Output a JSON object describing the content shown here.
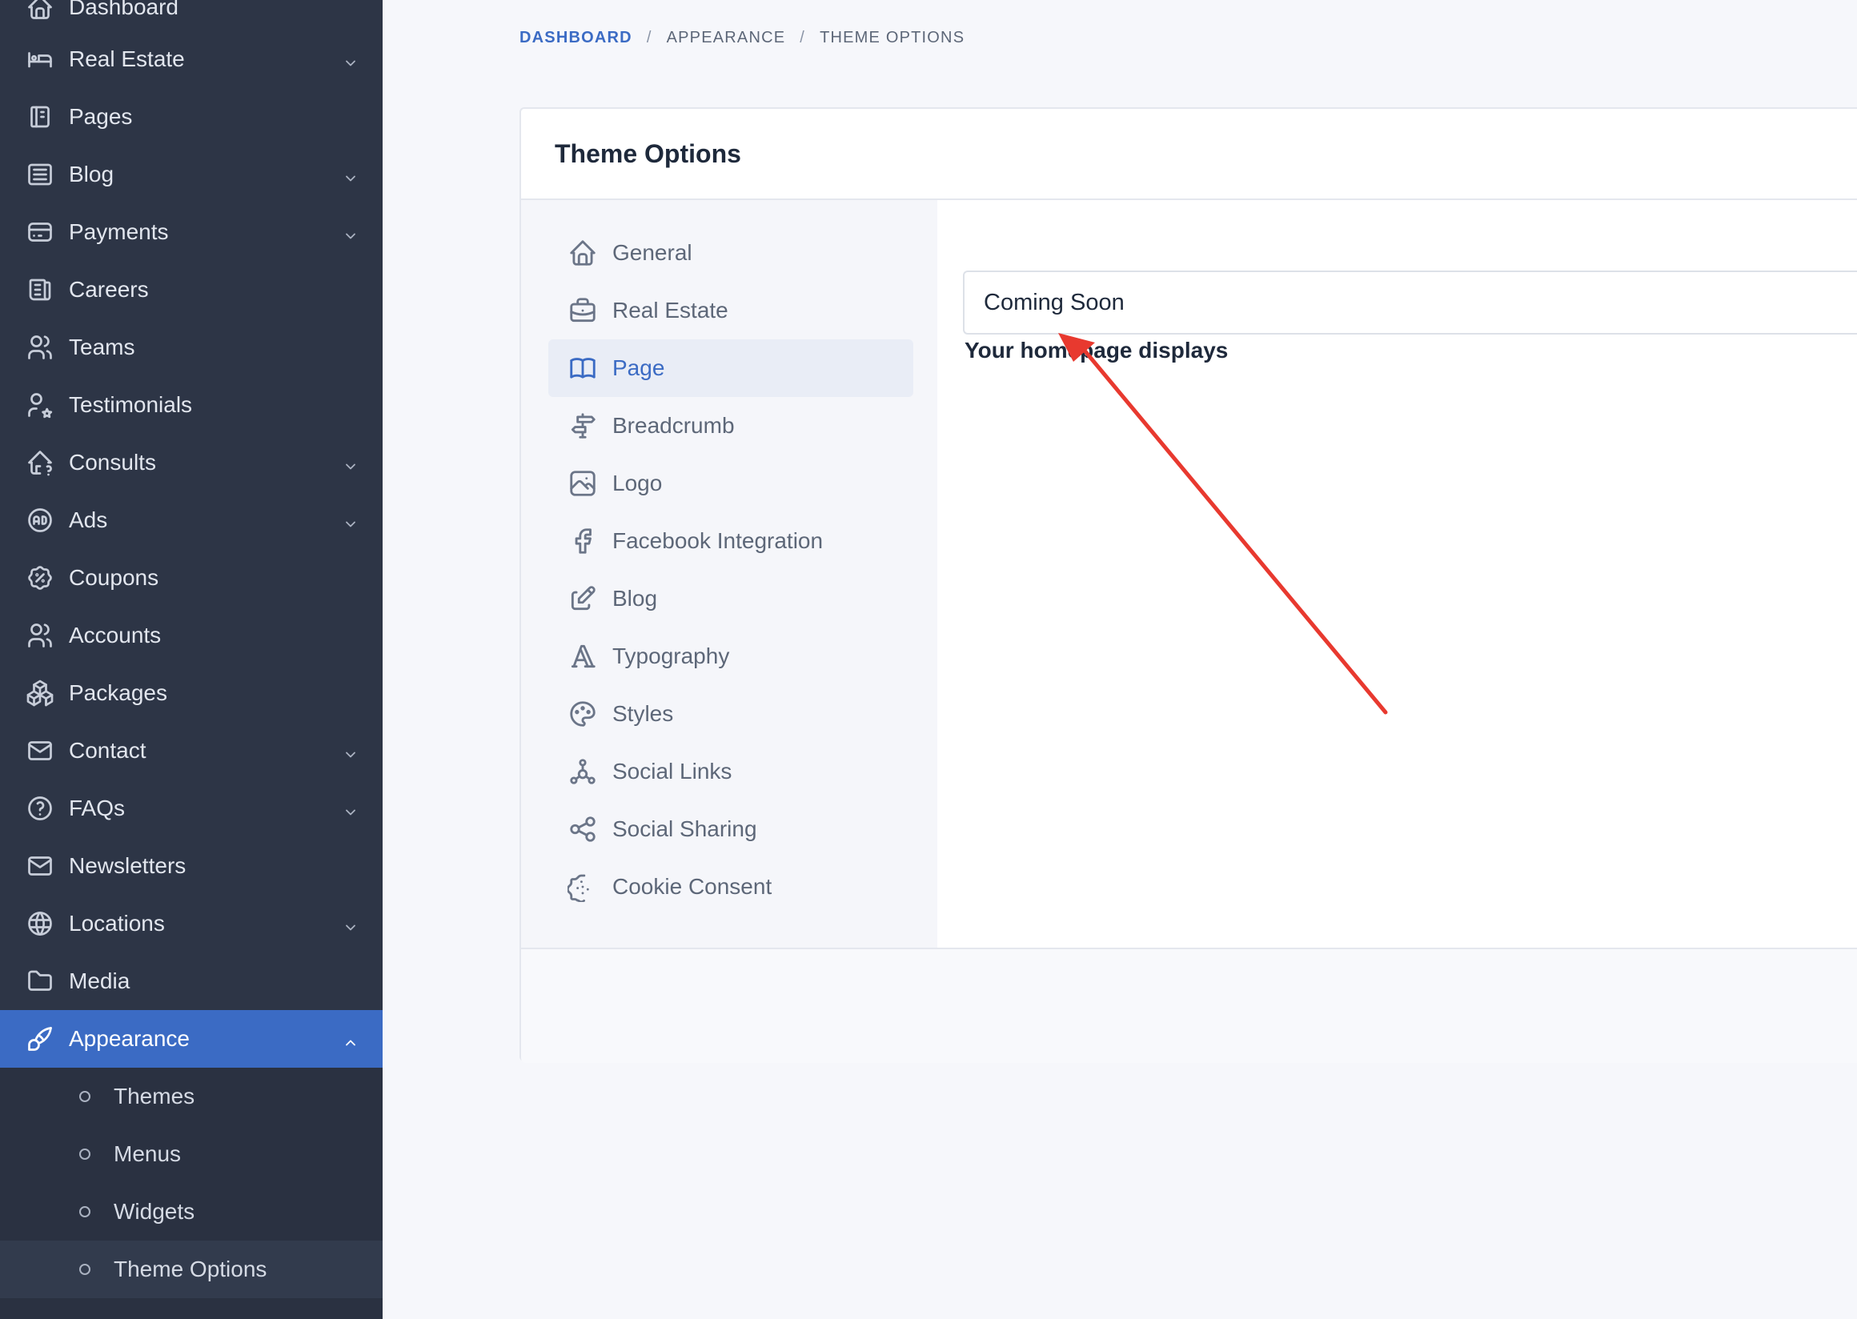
{
  "sidebar": {
    "items": [
      {
        "label": "Dashboard",
        "icon": "home-icon",
        "chevron": false
      },
      {
        "label": "Real Estate",
        "icon": "bed-icon",
        "chevron": true
      },
      {
        "label": "Pages",
        "icon": "notebook-icon",
        "chevron": false
      },
      {
        "label": "Blog",
        "icon": "article-icon",
        "chevron": true
      },
      {
        "label": "Payments",
        "icon": "credit-card-icon",
        "chevron": true
      },
      {
        "label": "Careers",
        "icon": "news-icon",
        "chevron": false
      },
      {
        "label": "Teams",
        "icon": "users-icon",
        "chevron": false
      },
      {
        "label": "Testimonials",
        "icon": "user-star-icon",
        "chevron": false
      },
      {
        "label": "Consults",
        "icon": "home-question-icon",
        "chevron": true
      },
      {
        "label": "Ads",
        "icon": "ad-circle-icon",
        "chevron": true
      },
      {
        "label": "Coupons",
        "icon": "discount-icon",
        "chevron": false
      },
      {
        "label": "Accounts",
        "icon": "users-icon",
        "chevron": false
      },
      {
        "label": "Packages",
        "icon": "packages-icon",
        "chevron": false
      },
      {
        "label": "Contact",
        "icon": "mail-icon",
        "chevron": true
      },
      {
        "label": "FAQs",
        "icon": "help-circle-icon",
        "chevron": true
      },
      {
        "label": "Newsletters",
        "icon": "mail-icon",
        "chevron": false
      },
      {
        "label": "Locations",
        "icon": "world-icon",
        "chevron": true
      },
      {
        "label": "Media",
        "icon": "folder-icon",
        "chevron": false
      },
      {
        "label": "Appearance",
        "icon": "brush-icon",
        "chevron": true,
        "active": true
      }
    ],
    "sub_items": [
      {
        "label": "Themes"
      },
      {
        "label": "Menus"
      },
      {
        "label": "Widgets"
      },
      {
        "label": "Theme Options",
        "current": true
      }
    ]
  },
  "breadcrumb": {
    "items": [
      "Dashboard",
      "Appearance",
      "Theme Options"
    ],
    "separator": "/"
  },
  "card": {
    "title": "Theme Options",
    "tabs": [
      {
        "label": "General",
        "icon": "home-icon"
      },
      {
        "label": "Real Estate",
        "icon": "briefcase-icon"
      },
      {
        "label": "Page",
        "icon": "book-icon",
        "active": true
      },
      {
        "label": "Breadcrumb",
        "icon": "directions-icon"
      },
      {
        "label": "Logo",
        "icon": "photo-icon"
      },
      {
        "label": "Facebook Integration",
        "icon": "facebook-icon"
      },
      {
        "label": "Blog",
        "icon": "edit-icon"
      },
      {
        "label": "Typography",
        "icon": "typography-icon"
      },
      {
        "label": "Styles",
        "icon": "palette-icon"
      },
      {
        "label": "Social Links",
        "icon": "network-icon"
      },
      {
        "label": "Social Sharing",
        "icon": "share-icon"
      },
      {
        "label": "Cookie Consent",
        "icon": "cookie-icon"
      }
    ],
    "field": {
      "label": "Your homepage displays",
      "value": "Coming Soon"
    }
  },
  "colors": {
    "sidebar_bg": "#2d3546",
    "accent": "#3b6bc4",
    "annotation_arrow": "#e8392f"
  }
}
